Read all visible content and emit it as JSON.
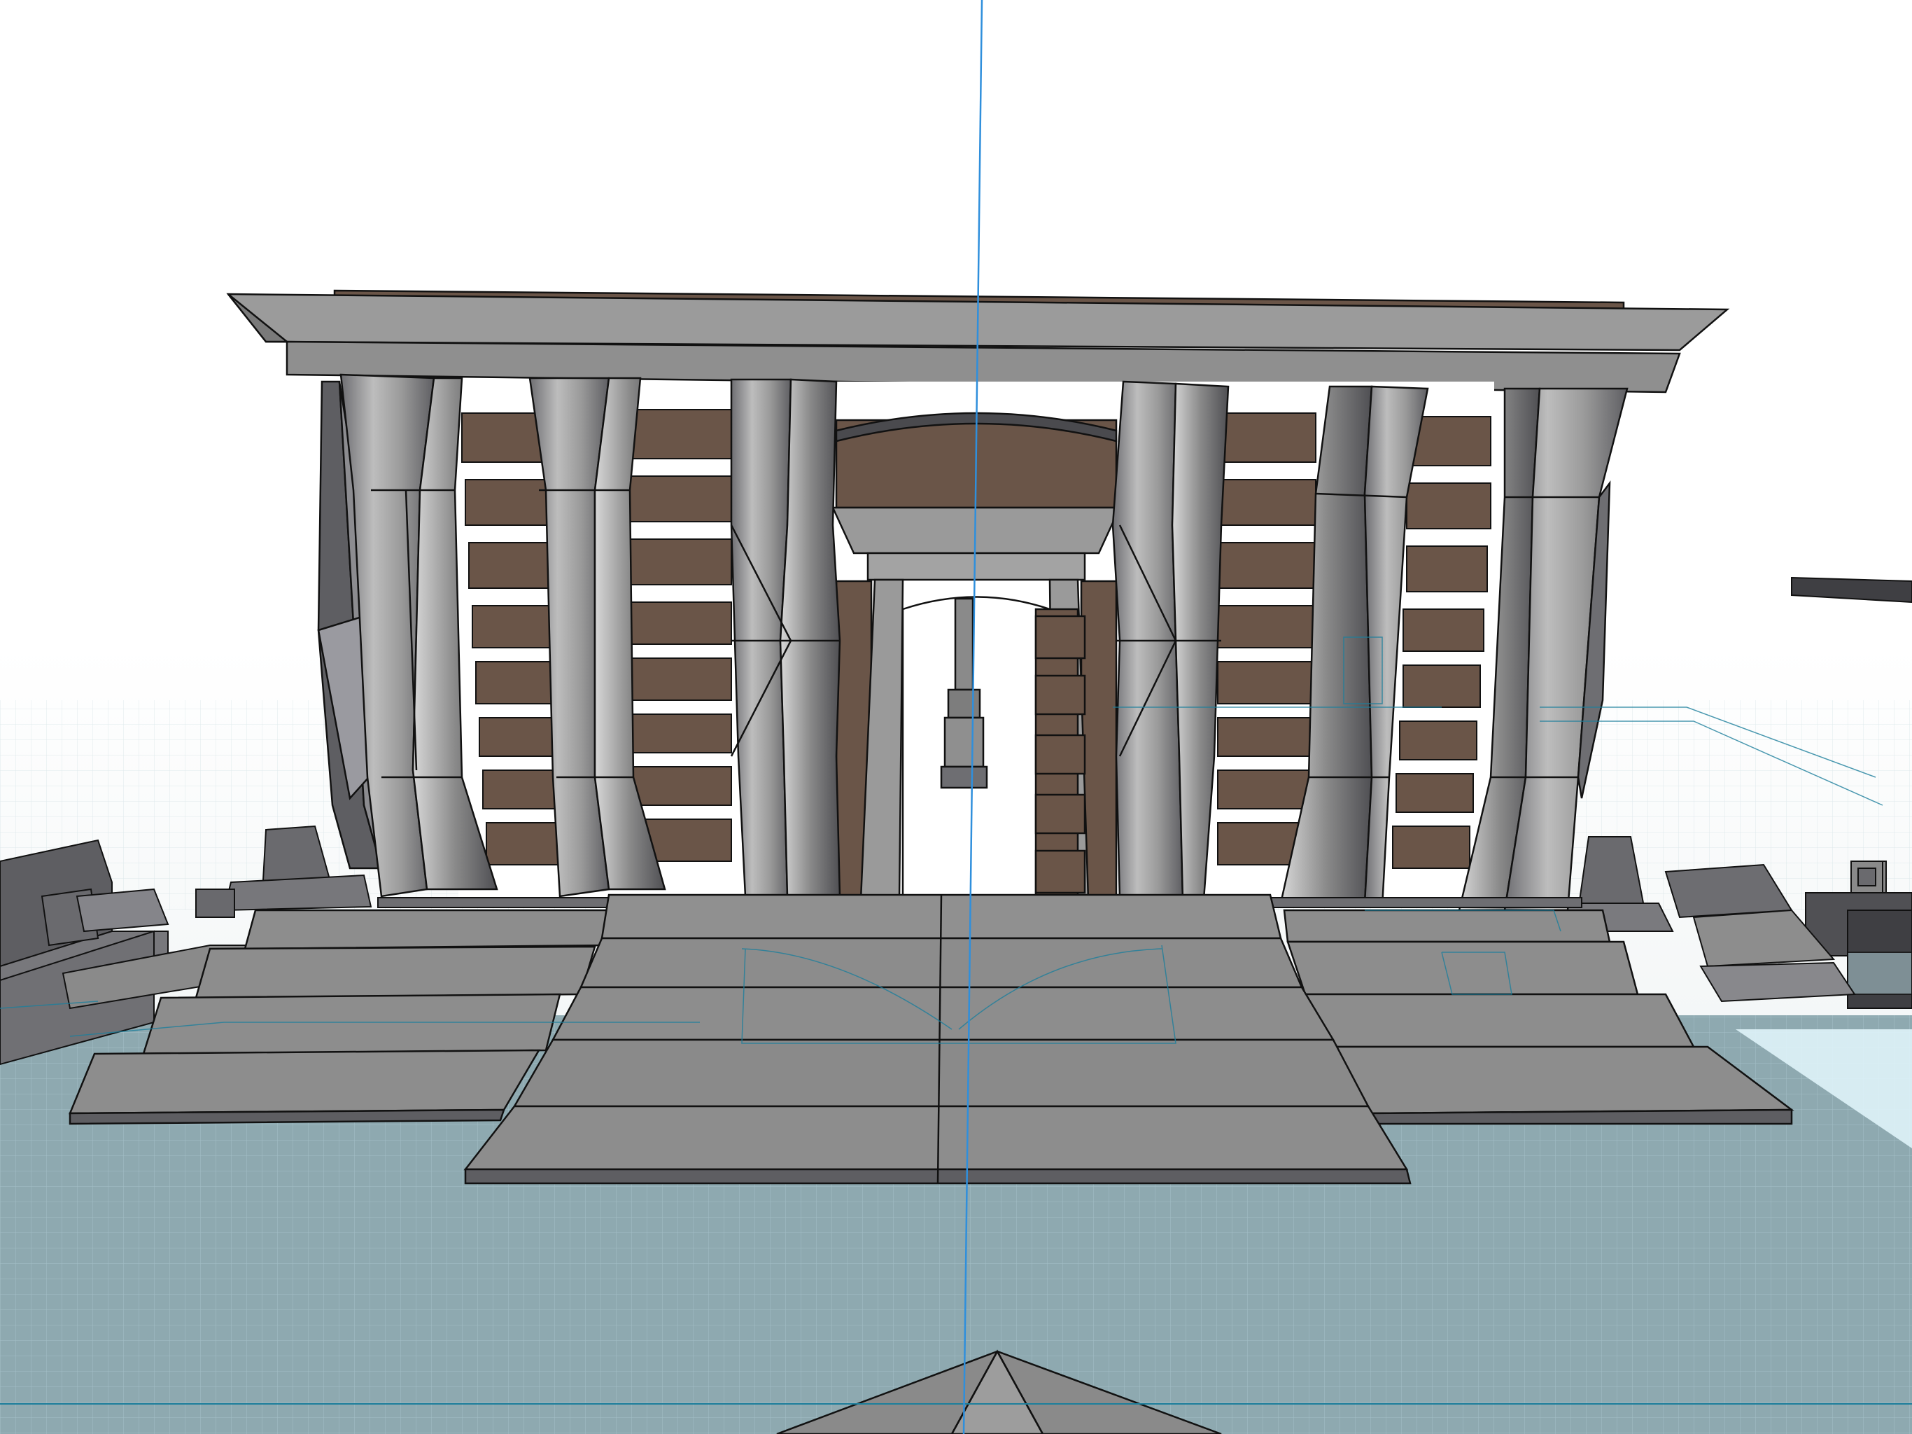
{
  "app": {
    "view": "3d-model-viewport",
    "mode": "shaded-with-edges"
  },
  "colors": {
    "background": "#ffffff",
    "ground_plane": "#8ea9b0",
    "grid_line": "#9fc2cb",
    "axis_line": "#2f8fdc",
    "guide_line": "#1d7f9c",
    "stone": "#8d8d8d",
    "stone_light": "#a6a6a6",
    "stone_dark": "#5e5e62",
    "wood": "#6a5548",
    "edge": "#111111",
    "water": "#dff3fa"
  },
  "scene": {
    "model": "temple-colonnade-with-steps",
    "column_count_left": 3,
    "column_count_right": 3,
    "step_count": 4
  }
}
